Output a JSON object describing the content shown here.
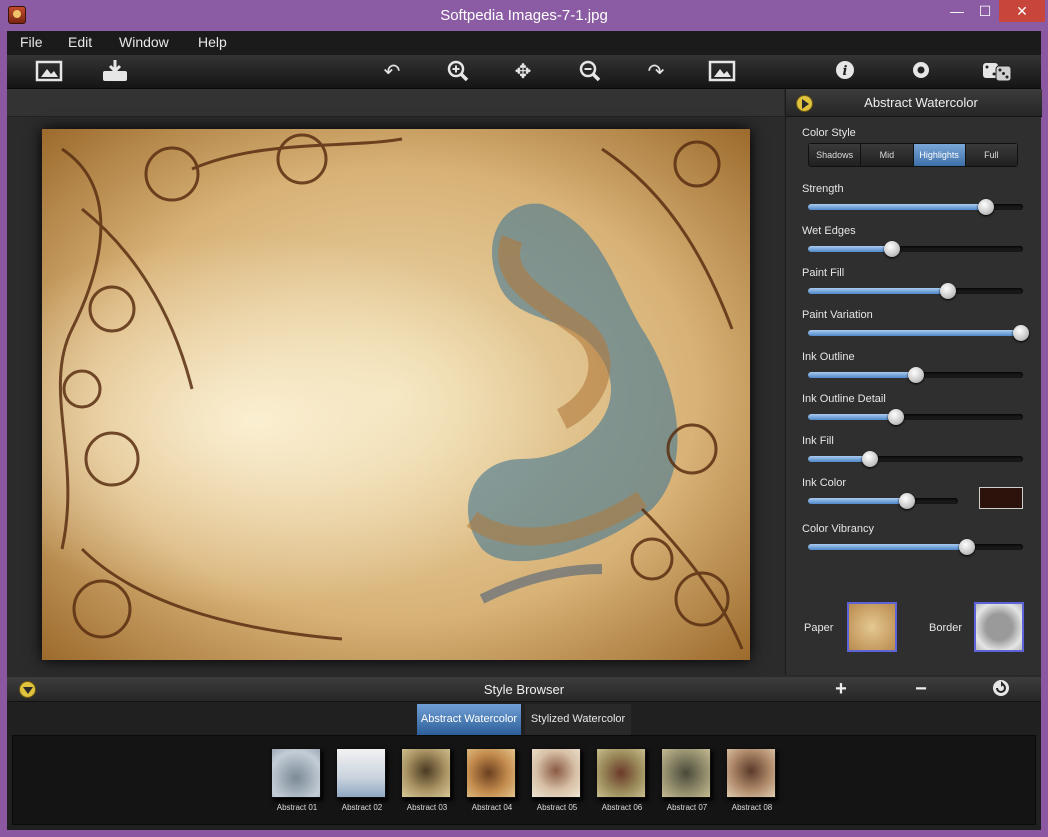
{
  "window": {
    "title": "Softpedia Images-7-1.jpg",
    "controls": {
      "minimize": "—",
      "maximize": "☐",
      "close": "✕"
    }
  },
  "menubar": {
    "items": [
      "File",
      "Edit",
      "Window",
      "Help"
    ]
  },
  "toolbar": {
    "icons": [
      "open-image-icon",
      "save-icon",
      "undo-icon",
      "zoom-in-icon",
      "move-icon",
      "zoom-out-icon",
      "redo-icon",
      "fit-image-icon",
      "info-icon",
      "settings-icon",
      "random-dice-icon"
    ]
  },
  "panel": {
    "title": "Abstract Watercolor",
    "color_style": {
      "label": "Color Style",
      "options": [
        "Shadows",
        "Mid",
        "Highlights",
        "Full"
      ],
      "selected": "Highlights"
    },
    "sliders": [
      {
        "label": "Strength",
        "value": 0.83
      },
      {
        "label": "Wet Edges",
        "value": 0.39
      },
      {
        "label": "Paint Fill",
        "value": 0.65
      },
      {
        "label": "Paint Variation",
        "value": 0.99
      },
      {
        "label": "Ink Outline",
        "value": 0.5
      },
      {
        "label": "Ink Outline Detail",
        "value": 0.41
      },
      {
        "label": "Ink Fill",
        "value": 0.29
      },
      {
        "label": "Ink Color",
        "value": 0.66
      },
      {
        "label": "Color Vibrancy",
        "value": 0.74
      }
    ],
    "ink_color": "#2b120b",
    "paper_label": "Paper",
    "border_label": "Border"
  },
  "style_browser": {
    "title": "Style Browser",
    "tabs": [
      "Abstract Watercolor",
      "Stylized Watercolor"
    ],
    "active_tab": "Abstract Watercolor",
    "thumbnails": [
      "Abstract 01",
      "Abstract 02",
      "Abstract 03",
      "Abstract 04",
      "Abstract 05",
      "Abstract 06",
      "Abstract 07",
      "Abstract 08"
    ]
  },
  "colors": {
    "titlebar": "#8b5ca3",
    "accent_blue": "#4f88c9",
    "highlight_yellow": "#e1c23c"
  }
}
